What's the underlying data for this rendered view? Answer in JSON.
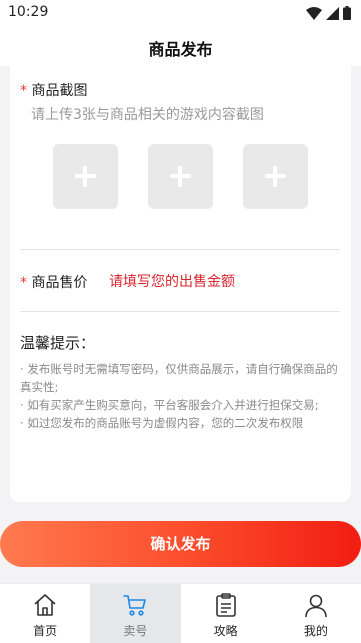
{
  "status": {
    "time": "10:29"
  },
  "header": {
    "title": "商品发布"
  },
  "screenshots": {
    "required_mark": "*",
    "label": "商品截图",
    "hint": "请上传3张与商品相关的游戏内容截图",
    "slots": [
      "add",
      "add",
      "add"
    ]
  },
  "price": {
    "required_mark": "*",
    "label": "商品售价",
    "placeholder": "请填写您的出售金额"
  },
  "tips": {
    "title": "温馨提示：",
    "items": [
      "· 发布账号时无需填写密码，仅供商品展示，请自行确保商品的真实性;",
      "· 如有买家产生购买意向，平台客服会介入并进行担保交易;",
      "· 如过您发布的商品账号为虚假内容，您的二次发布权限"
    ]
  },
  "confirm_label": "确认发布",
  "tabs": [
    {
      "label": "首页",
      "icon": "home-icon",
      "active": false
    },
    {
      "label": "卖号",
      "icon": "cart-icon",
      "active": true
    },
    {
      "label": "攻略",
      "icon": "clipboard-icon",
      "active": false
    },
    {
      "label": "我的",
      "icon": "user-icon",
      "active": false
    }
  ],
  "colors": {
    "accent": "#e53935",
    "price_placeholder": "#d9252e",
    "button_start": "#ff7a4f",
    "button_end": "#f21d12"
  }
}
